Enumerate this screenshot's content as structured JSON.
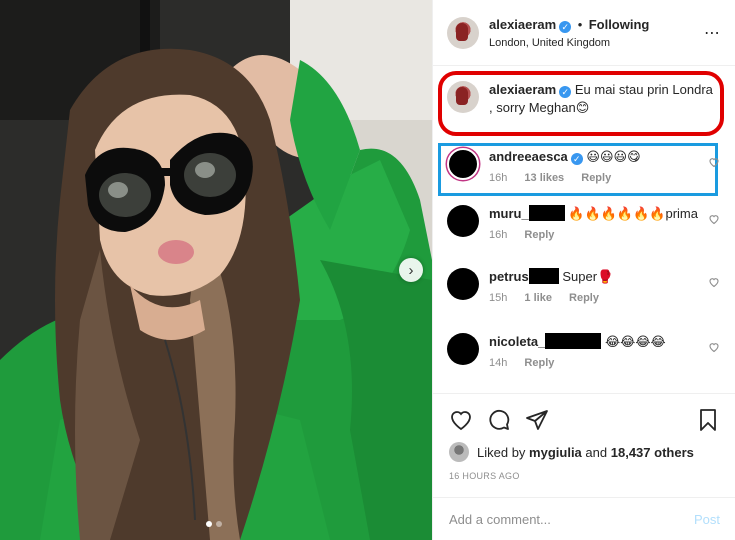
{
  "header": {
    "username": "alexiaeram",
    "separator": "•",
    "follow_label": "Following",
    "location": "London, United Kingdom",
    "more_icon": "⋯"
  },
  "caption": {
    "username": "alexiaeram",
    "text": "Eu mai stau prin Londra , sorry Meghan😊"
  },
  "comments": [
    {
      "username": "andreeaesca",
      "verified": true,
      "text": "😃😃😃😋",
      "time": "16h",
      "likes": "13 likes",
      "reply": "Reply"
    },
    {
      "username": "muru_",
      "text": "🔥🔥🔥🔥🔥🔥prima",
      "time": "16h",
      "reply": "Reply"
    },
    {
      "username": "petrus",
      "text": "Super🥊",
      "time": "15h",
      "likes": "1 like",
      "reply": "Reply"
    },
    {
      "username": "nicoleta_",
      "text": "😂😂😂😂",
      "time": "14h",
      "reply": "Reply"
    }
  ],
  "likes": {
    "prefix": "Liked by",
    "user": "mygiulia",
    "joiner": "and",
    "others": "18,437 others"
  },
  "time_ago": "16 HOURS AGO",
  "add_comment": {
    "placeholder": "Add a comment...",
    "post_label": "Post"
  },
  "carousel": {
    "next_icon": "›",
    "slide_count": 2,
    "active_index": 0
  },
  "colors": {
    "highlight_red": "#e00000",
    "highlight_blue": "#1a9be0",
    "verified_blue": "#3897f0",
    "post_disabled": "#b2dffc"
  }
}
